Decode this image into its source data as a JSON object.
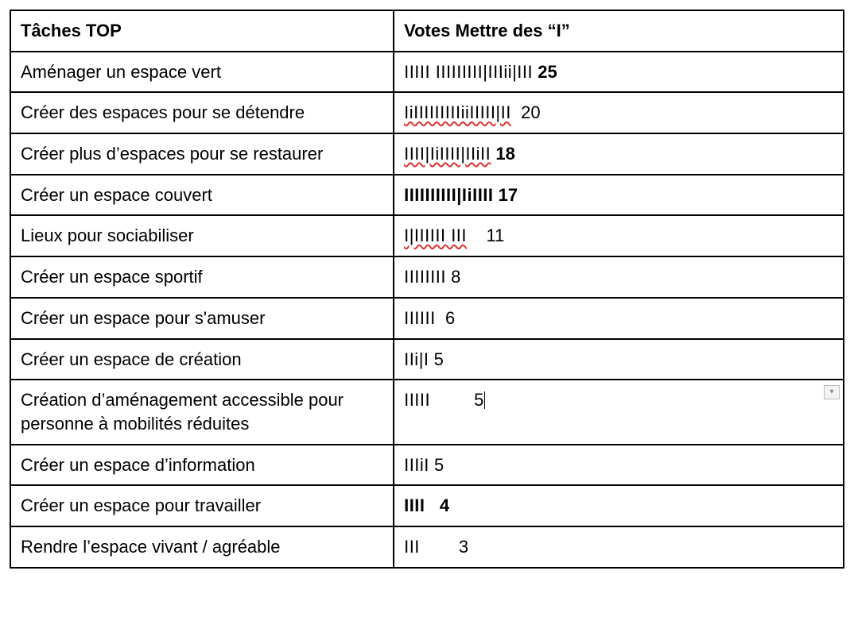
{
  "table": {
    "headers": {
      "tasks": "Tâches TOP",
      "votes": "Votes Mettre des “I”"
    },
    "rows": [
      {
        "task": "Aménager un espace vert",
        "tally": "IIIII IIIIIIIII|IIIii|III",
        "count": " 25",
        "tally_bold": false,
        "count_bold": true,
        "typo_underline": false
      },
      {
        "task": "Créer des espaces pour se détendre",
        "tally": "IiIIIIIIIIIiiIIIII|II",
        "count": "  20",
        "tally_bold": false,
        "count_bold": false,
        "typo_underline": true
      },
      {
        "task": "Créer plus d’espaces pour se restaurer",
        "tally": "IIII|IiIIII|IIiII",
        "count": " 18",
        "tally_bold": false,
        "count_bold": true,
        "typo_underline": true
      },
      {
        "task": "Créer un espace couvert",
        "tally": "IIIIIIIIII|IiIIII",
        "count": " 17",
        "tally_bold": true,
        "count_bold": true,
        "typo_underline": false
      },
      {
        "task": "Lieux pour sociabiliser",
        "tally": "I|IIIIII III",
        "count": "    11",
        "tally_bold": false,
        "count_bold": false,
        "typo_underline": true
      },
      {
        "task": "Créer un espace sportif",
        "tally": "IIIIIIII",
        "count": " 8",
        "tally_bold": false,
        "count_bold": false,
        "typo_underline": false
      },
      {
        "task": "Créer un espace pour s'amuser",
        "tally": "IIIIII",
        "count": "  6",
        "tally_bold": false,
        "count_bold": false,
        "typo_underline": false
      },
      {
        "task": "Créer un espace de création",
        "tally": "IIi|I",
        "count": " 5",
        "tally_bold": false,
        "count_bold": false,
        "typo_underline": false
      },
      {
        "task": "Création d’aménagement accessible pour personne à mobilités réduites",
        "tally": "IIIII",
        "count": "         5",
        "tally_bold": false,
        "count_bold": false,
        "typo_underline": false,
        "show_dropdown": true,
        "show_cursor": true
      },
      {
        "task": "Créer un espace d’information",
        "tally": "IIIiI",
        "count": " 5",
        "tally_bold": false,
        "count_bold": false,
        "typo_underline": false
      },
      {
        "task": "Créer un espace pour travailler",
        "tally": "IIII",
        "count": "   4",
        "tally_bold": true,
        "count_bold": true,
        "typo_underline": false
      },
      {
        "task": "Rendre l’espace vivant / agréable",
        "tally": "III",
        "count": "        3",
        "tally_bold": false,
        "count_bold": false,
        "typo_underline": false
      }
    ]
  }
}
